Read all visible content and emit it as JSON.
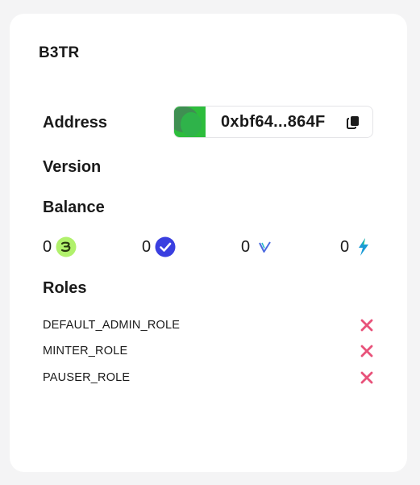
{
  "card": {
    "title": "B3TR"
  },
  "labels": {
    "address": "Address",
    "version": "Version",
    "balance": "Balance",
    "roles": "Roles"
  },
  "address": {
    "display": "0xbf64...864F",
    "avatar_colors": [
      "#2dbd3c",
      "#3f8f52"
    ],
    "copy_icon": "copy-icon"
  },
  "balances": [
    {
      "value": "0",
      "icon": "b3tr-token-icon"
    },
    {
      "value": "0",
      "icon": "vot3-token-icon"
    },
    {
      "value": "0",
      "icon": "vet-token-icon"
    },
    {
      "value": "0",
      "icon": "vtho-token-icon"
    }
  ],
  "roles": [
    {
      "name": "DEFAULT_ADMIN_ROLE",
      "granted": false,
      "icon": "close-icon"
    },
    {
      "name": "MINTER_ROLE",
      "granted": false,
      "icon": "close-icon"
    },
    {
      "name": "PAUSER_ROLE",
      "granted": false,
      "icon": "close-icon"
    }
  ],
  "colors": {
    "deny": "#e8527a",
    "b3tr": "#b1f16c",
    "vot3": "#3a3fe0",
    "vet": "#4c6ae0",
    "vtho": "#1b9bd6"
  }
}
